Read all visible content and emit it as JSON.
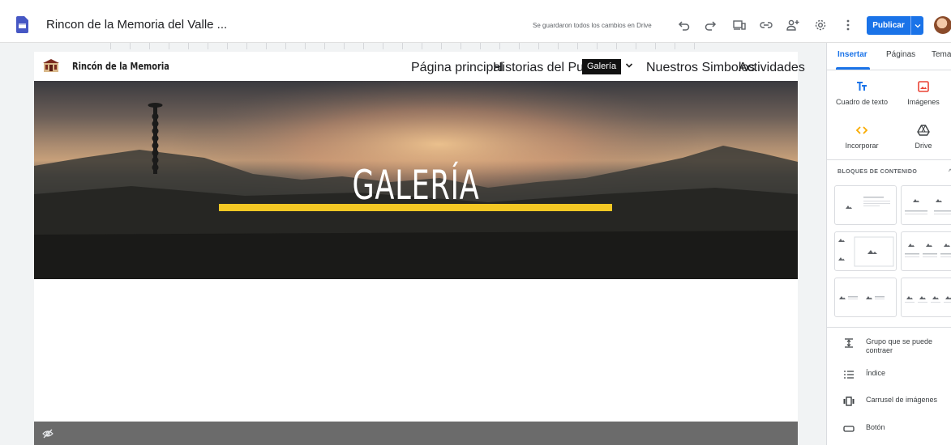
{
  "app": {
    "doc_title": "Rincon de la Memoria del Valle ...",
    "save_status": "Se guardaron todos los cambios en Drive",
    "publish_label": "Publicar",
    "accent_color": "#1a73e8"
  },
  "site": {
    "name": "Rincón de la Memoria",
    "nav": [
      {
        "label": "Página principal"
      },
      {
        "label": "Historias del Pueblo"
      },
      {
        "label": "Galería"
      },
      {
        "label": "Nuestros Simbolos"
      },
      {
        "label": "Actividades"
      }
    ],
    "active_nav": "Galería",
    "hero_title": "GALERÍA",
    "hero_bar_color": "#f4c824"
  },
  "panel": {
    "tabs": [
      "Insertar",
      "Páginas",
      "Temas"
    ],
    "active_tab": "Insertar",
    "insert_items": [
      {
        "label": "Cuadro de texto",
        "icon": "text-box-icon"
      },
      {
        "label": "Imágenes",
        "icon": "image-icon"
      },
      {
        "label": "Incorporar",
        "icon": "embed-icon"
      },
      {
        "label": "Drive",
        "icon": "drive-icon"
      }
    ],
    "content_blocks_title": "BLOQUES DE CONTENIDO",
    "list_items": [
      {
        "label": "Grupo que se puede contraer",
        "icon": "collapsible-group-icon"
      },
      {
        "label": "Índice",
        "icon": "table-of-contents-icon"
      },
      {
        "label": "Carrusel de imágenes",
        "icon": "image-carousel-icon"
      },
      {
        "label": "Botón",
        "icon": "button-icon"
      }
    ]
  }
}
